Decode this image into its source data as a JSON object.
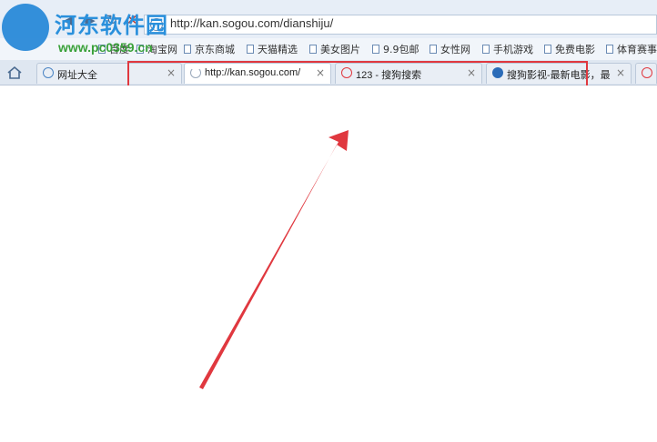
{
  "address": {
    "url": "http://kan.sogou.com/dianshiju/"
  },
  "bookmarks": [
    {
      "label": "百度"
    },
    {
      "label": "淘宝网"
    },
    {
      "label": "京东商城"
    },
    {
      "label": "天猫精选"
    },
    {
      "label": "美女图片"
    },
    {
      "label": "9.9包邮"
    },
    {
      "label": "女性网"
    },
    {
      "label": "手机游戏"
    },
    {
      "label": "免费电影"
    },
    {
      "label": "体育赛事"
    }
  ],
  "tabs": [
    {
      "label": "网址大全",
      "close": "×"
    },
    {
      "label": "http://kan.sogou.com/",
      "close": "×"
    },
    {
      "label": "123 - 搜狗搜索",
      "close": "×"
    },
    {
      "label": "搜狗影视-最新电影，最",
      "close": "×"
    }
  ],
  "watermark": {
    "title": "河东软件园",
    "url": "www.pc0359.cn"
  },
  "colors": {
    "highlight": "#e0383f",
    "arrow": "#e0383f"
  }
}
